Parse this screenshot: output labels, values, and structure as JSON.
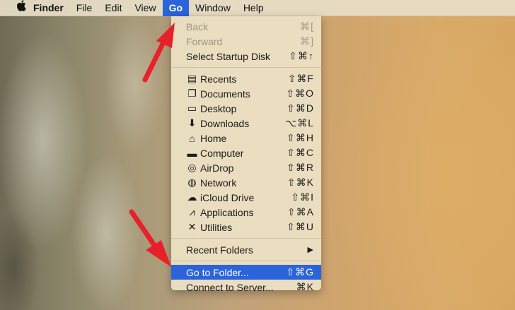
{
  "menubar": {
    "items": [
      "Finder",
      "File",
      "Edit",
      "View",
      "Go",
      "Window",
      "Help"
    ]
  },
  "menu": {
    "group1": [
      {
        "label": "Back",
        "shortcut": "⌘[",
        "disabled": true
      },
      {
        "label": "Forward",
        "shortcut": "⌘]",
        "disabled": true
      },
      {
        "label": "Select Startup Disk",
        "shortcut": "⇧⌘↑"
      }
    ],
    "group2": [
      {
        "label": "Recents",
        "shortcut": "⇧⌘F",
        "icon": "recents-icon"
      },
      {
        "label": "Documents",
        "shortcut": "⇧⌘O",
        "icon": "documents-icon"
      },
      {
        "label": "Desktop",
        "shortcut": "⇧⌘D",
        "icon": "desktop-icon"
      },
      {
        "label": "Downloads",
        "shortcut": "⌥⌘L",
        "icon": "downloads-icon"
      },
      {
        "label": "Home",
        "shortcut": "⇧⌘H",
        "icon": "home-icon"
      },
      {
        "label": "Computer",
        "shortcut": "⇧⌘C",
        "icon": "computer-icon"
      },
      {
        "label": "AirDrop",
        "shortcut": "⇧⌘R",
        "icon": "airdrop-icon"
      },
      {
        "label": "Network",
        "shortcut": "⇧⌘K",
        "icon": "network-icon"
      },
      {
        "label": "iCloud Drive",
        "shortcut": "⇧⌘I",
        "icon": "icloud-icon"
      },
      {
        "label": "Applications",
        "shortcut": "⇧⌘A",
        "icon": "applications-icon"
      },
      {
        "label": "Utilities",
        "shortcut": "⇧⌘U",
        "icon": "utilities-icon"
      }
    ],
    "recent_folders": {
      "label": "Recent Folders",
      "shortcut": "▶"
    },
    "group4": [
      {
        "label": "Go to Folder...",
        "shortcut": "⇧⌘G",
        "highlighted": true
      },
      {
        "label": "Connect to Server...",
        "shortcut": "⌘K"
      }
    ]
  },
  "colors": {
    "highlight": "#2b63d8",
    "arrow": "#e8202a"
  }
}
